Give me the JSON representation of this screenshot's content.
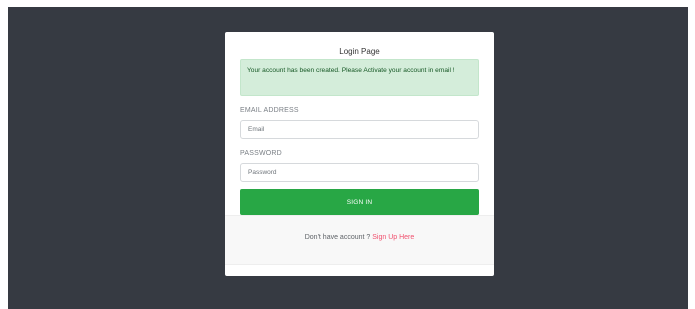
{
  "login": {
    "title": "Login Page",
    "alert_message": "Your account has been created. Please Activate your account in email !",
    "email_label": "EMAIL ADDRESS",
    "email_placeholder": "Email",
    "email_value": "",
    "password_label": "PASSWORD",
    "password_placeholder": "Password",
    "password_value": "",
    "signin_label": "SIGN IN",
    "footer_text": "Don't have account ? ",
    "signup_link": "Sign Up Here"
  },
  "colors": {
    "backdrop": "#363a42",
    "alert_bg": "#d4edda",
    "alert_text": "#155724",
    "button": "#28a745",
    "link": "#f0506e"
  }
}
